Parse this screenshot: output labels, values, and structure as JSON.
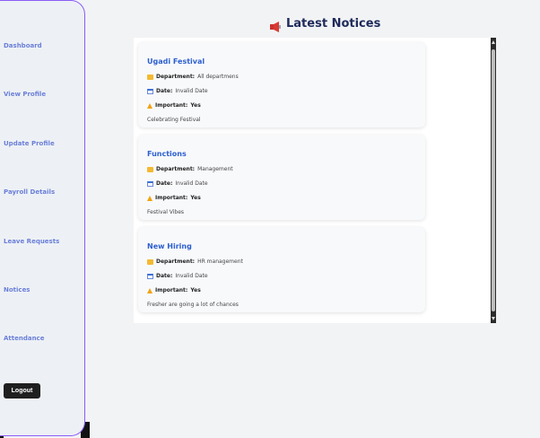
{
  "sidebar": {
    "items": [
      {
        "label": "Dashboard"
      },
      {
        "label": "View Profile"
      },
      {
        "label": "Update Profile"
      },
      {
        "label": "Payroll Details"
      },
      {
        "label": "Leave Requests"
      },
      {
        "label": "Notices"
      },
      {
        "label": "Attendance"
      }
    ],
    "logout_label": "Logout"
  },
  "header": {
    "title": "Latest Notices",
    "icon": "megaphone-icon"
  },
  "labels": {
    "department": "Department:",
    "date": "Date:",
    "important": "Important:"
  },
  "notices": [
    {
      "title": "Ugadi Festival",
      "department": "All departmens",
      "date": "Invalid Date",
      "important": "Yes",
      "description": "Celebrating Festival"
    },
    {
      "title": "Functions",
      "department": "Management",
      "date": "Invalid Date",
      "important": "Yes",
      "description": "Festival Vibes"
    },
    {
      "title": "New Hiring",
      "department": "HR management",
      "date": "Invalid Date",
      "important": "Yes",
      "description": "Fresher are going a lot of chances"
    }
  ],
  "colors": {
    "accent": "#2c5fcf",
    "nav_text": "#6b7fd8",
    "sidebar_border": "#8b5cf6",
    "heading": "#1e2a5a"
  }
}
